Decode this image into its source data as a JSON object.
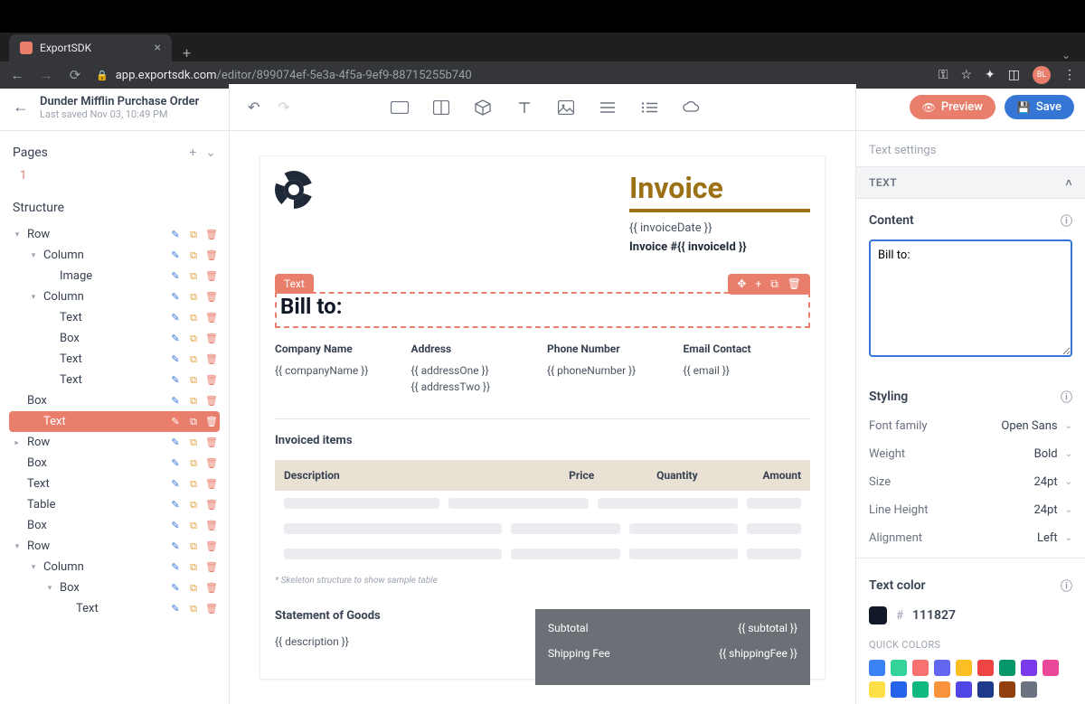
{
  "browser": {
    "tab_title": "ExportSDK",
    "url_host": "app.exportsdk.com",
    "url_path": "/editor/899074ef-5e3a-4f5a-9ef9-88715255b740",
    "avatar_initials": "BL"
  },
  "doc": {
    "title": "Dunder Mifflin Purchase Order",
    "saved": "Last saved Nov 03, 10:49 PM"
  },
  "buttons": {
    "preview": "Preview",
    "save": "Save"
  },
  "pages": {
    "heading": "Pages",
    "items": [
      "1"
    ]
  },
  "structure": {
    "heading": "Structure"
  },
  "tree": [
    {
      "label": "Row",
      "d": 0,
      "tog": "down"
    },
    {
      "label": "Column",
      "d": 1,
      "tog": "down"
    },
    {
      "label": "Image",
      "d": 2
    },
    {
      "label": "Column",
      "d": 1,
      "tog": "down"
    },
    {
      "label": "Text",
      "d": 2
    },
    {
      "label": "Box",
      "d": 2
    },
    {
      "label": "Text",
      "d": 2
    },
    {
      "label": "Text",
      "d": 2
    },
    {
      "label": "Box",
      "d": 0
    },
    {
      "label": "Text",
      "d": 1,
      "active": true
    },
    {
      "label": "Row",
      "d": 0,
      "tog": "right"
    },
    {
      "label": "Box",
      "d": 0
    },
    {
      "label": "Text",
      "d": 0
    },
    {
      "label": "Table",
      "d": 0
    },
    {
      "label": "Box",
      "d": 0
    },
    {
      "label": "Row",
      "d": 0,
      "tog": "down"
    },
    {
      "label": "Column",
      "d": 1,
      "tog": "down"
    },
    {
      "label": "Box",
      "d": 2,
      "tog": "down"
    },
    {
      "label": "Text",
      "d": 3
    }
  ],
  "canvas": {
    "invoice_title": "Invoice",
    "invoice_date": "{{ invoiceDate }}",
    "invoice_id_label": "Invoice #{{ invoiceId }}",
    "selected_badge": "Text",
    "bill_to_heading": "Bill to:",
    "cols": {
      "company_h": "Company Name",
      "company_v": "{{ companyName }}",
      "address_h": "Address",
      "address_v1": "{{ addressOne }}",
      "address_v2": "{{ addressTwo }}",
      "phone_h": "Phone Number",
      "phone_v": "{{ phoneNumber }}",
      "email_h": "Email Contact",
      "email_v": "{{ email }}"
    },
    "invoiced_items": "Invoiced items",
    "th_desc": "Description",
    "th_price": "Price",
    "th_qty": "Quantity",
    "th_amt": "Amount",
    "skeleton_note": "* Skeleton structure to show sample table",
    "stmt_heading": "Statement of Goods",
    "stmt_desc": "{{ description }}",
    "subtotal_l": "Subtotal",
    "subtotal_v": "{{ subtotal }}",
    "shipping_l": "Shipping Fee",
    "shipping_v": "{{ shippingFee }}"
  },
  "rpanel": {
    "text_settings": "Text settings",
    "section_text": "TEXT",
    "content_label": "Content",
    "content_value": "Bill to:",
    "styling_label": "Styling",
    "font_family_l": "Font family",
    "font_family_v": "Open Sans",
    "weight_l": "Weight",
    "weight_v": "Bold",
    "size_l": "Size",
    "size_v": "24pt",
    "lineheight_l": "Line Height",
    "lineheight_v": "24pt",
    "align_l": "Alignment",
    "align_v": "Left",
    "text_color_label": "Text color",
    "hex": "111827",
    "quick_colors_label": "QUICK COLORS",
    "quick_colors": [
      "#3b82f6",
      "#34d399",
      "#f87171",
      "#6366f1",
      "#fbbf24",
      "#ef4444",
      "#059669",
      "#7c3aed",
      "#ec4899",
      "#fde047",
      "#2563eb",
      "#10b981",
      "#fb923c",
      "#4f46e5",
      "#1e3a8a",
      "#92400e",
      "#6b7280"
    ]
  }
}
